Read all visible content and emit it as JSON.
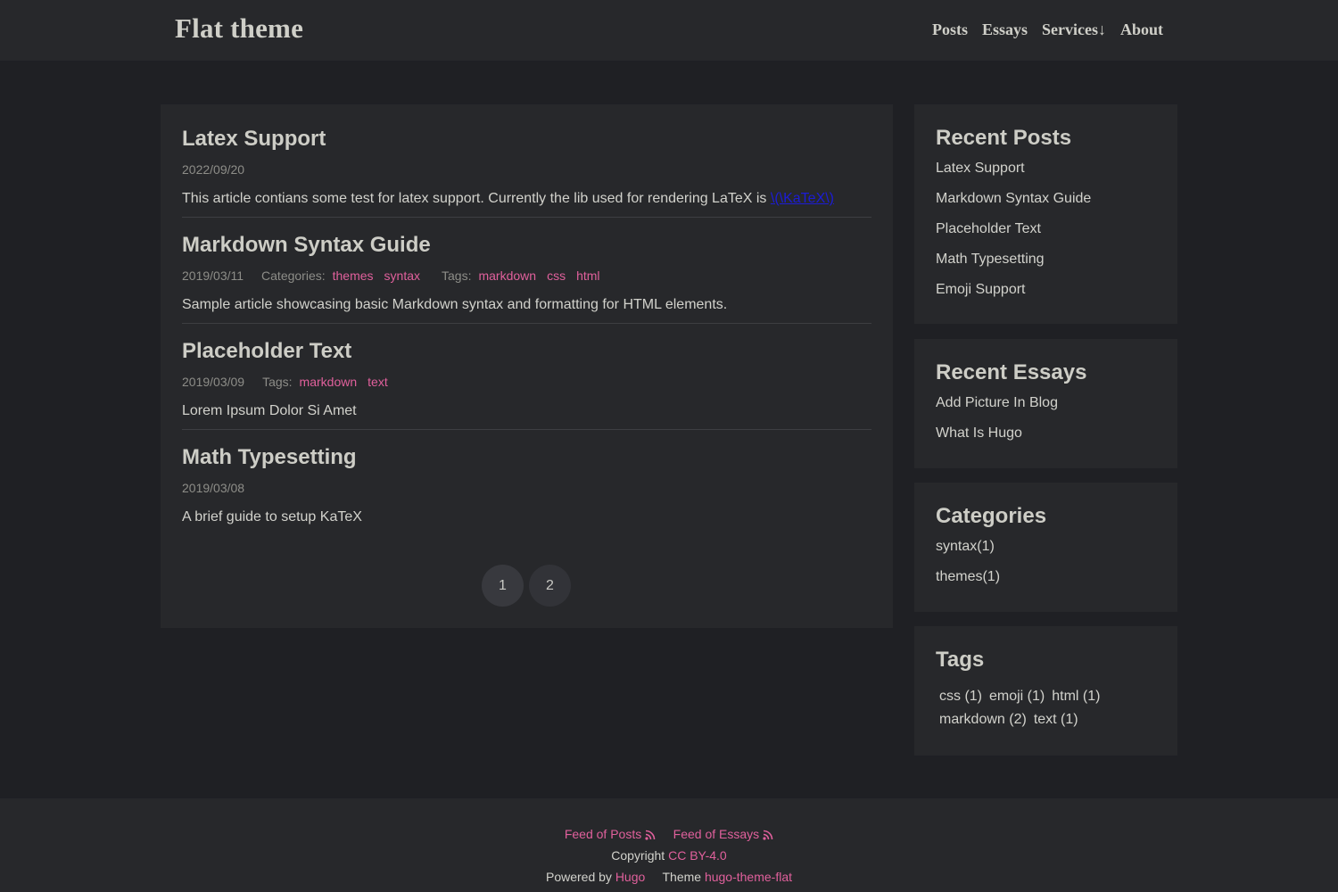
{
  "header": {
    "site_title": "Flat theme",
    "nav": [
      "Posts",
      "Essays",
      "Services↓",
      "About"
    ]
  },
  "posts": [
    {
      "title": "Latex Support",
      "date": "2022/09/20",
      "summary": "This article contians some test for latex support. Currently the lib used for rendering LaTeX is ",
      "summary_link": "\\(\\KaTeX\\)"
    },
    {
      "title": "Markdown Syntax Guide",
      "date": "2019/03/11",
      "categories_label": "Categories:",
      "categories": [
        "themes",
        "syntax"
      ],
      "tags_label": "Tags:",
      "tags": [
        "markdown",
        "css",
        "html"
      ],
      "summary": "Sample article showcasing basic Markdown syntax and formatting for HTML elements."
    },
    {
      "title": "Placeholder Text",
      "date": "2019/03/09",
      "tags_label": "Tags:",
      "tags": [
        "markdown",
        "text"
      ],
      "summary": "Lorem Ipsum Dolor Si Amet"
    },
    {
      "title": "Math Typesetting",
      "date": "2019/03/08",
      "summary": "A brief guide to setup KaTeX"
    }
  ],
  "pagination": {
    "pages": [
      "1",
      "2"
    ],
    "current": "1"
  },
  "sidebar": {
    "recent_posts": {
      "title": "Recent Posts",
      "items": [
        "Latex Support",
        "Markdown Syntax Guide",
        "Placeholder Text",
        "Math Typesetting",
        "Emoji Support"
      ]
    },
    "recent_essays": {
      "title": "Recent Essays",
      "items": [
        "Add Picture In Blog",
        "What Is Hugo"
      ]
    },
    "categories": {
      "title": "Categories",
      "items": [
        "syntax(1)",
        "themes(1)"
      ]
    },
    "tags": {
      "title": "Tags",
      "items": [
        "css (1)",
        "emoji (1)",
        "html (1)",
        "markdown (2)",
        "text (1)"
      ]
    }
  },
  "footer": {
    "feed_posts": "Feed of Posts",
    "feed_essays": "Feed of Essays",
    "copyright_label": "Copyright",
    "license": "CC BY-4.0",
    "powered_label": "Powered by",
    "hugo": "Hugo",
    "theme_label": "Theme",
    "theme_name": "hugo-theme-flat"
  },
  "colors": {
    "background": "#1f2024",
    "panel": "#27282b",
    "accent_pink": "#e0609c",
    "text": "#d2d2cc",
    "muted": "#8d8d88",
    "katex_link": "#1c1cd6"
  }
}
